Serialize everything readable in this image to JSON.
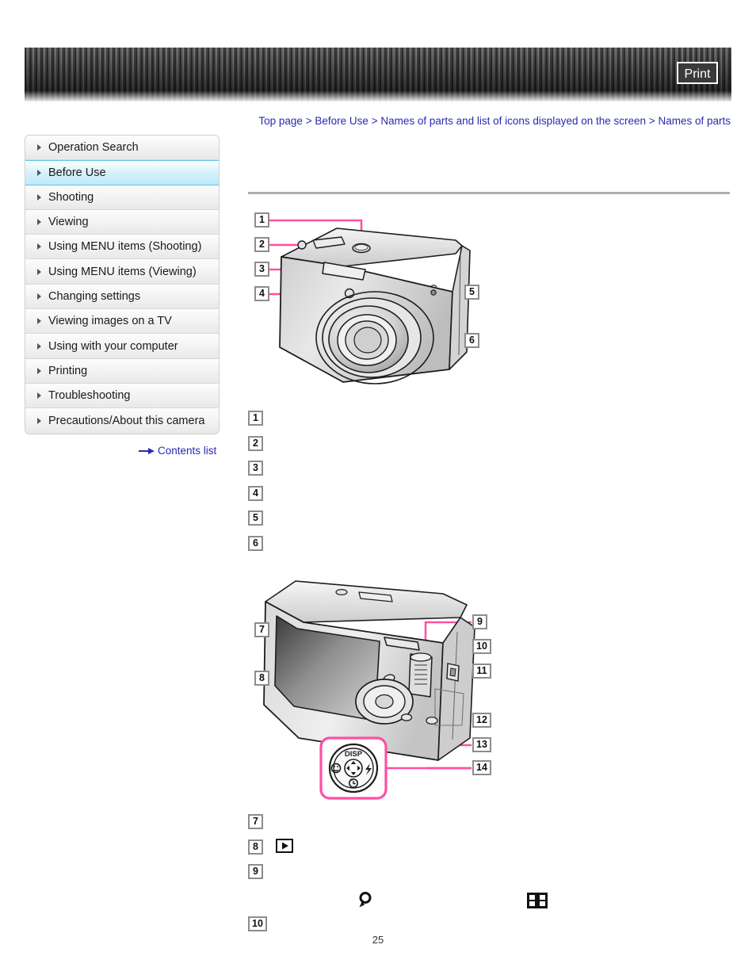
{
  "banner": {
    "print_label": "Print"
  },
  "breadcrumb": {
    "separator": ">",
    "items": [
      {
        "label": "Top page"
      },
      {
        "label": "Before Use"
      },
      {
        "label": "Names of parts and list of icons displayed on the screen"
      },
      {
        "label": "Names of parts"
      }
    ]
  },
  "sidebar": {
    "items": [
      {
        "label": "Operation Search",
        "active": false
      },
      {
        "label": "Before Use",
        "active": true
      },
      {
        "label": "Shooting",
        "active": false
      },
      {
        "label": "Viewing",
        "active": false
      },
      {
        "label": "Using MENU items (Shooting)",
        "active": false
      },
      {
        "label": "Using MENU items (Viewing)",
        "active": false
      },
      {
        "label": "Changing settings",
        "active": false
      },
      {
        "label": "Viewing images on a TV",
        "active": false
      },
      {
        "label": "Using with your computer",
        "active": false
      },
      {
        "label": "Printing",
        "active": false
      },
      {
        "label": "Troubleshooting",
        "active": false
      },
      {
        "label": "Precautions/About this camera",
        "active": false
      }
    ],
    "contents_list_label": "Contents list"
  },
  "figures": {
    "front": {
      "callouts": [
        "1",
        "2",
        "3",
        "4",
        "5",
        "6"
      ]
    },
    "rear": {
      "callouts": [
        "7",
        "8",
        "9",
        "10",
        "11",
        "12",
        "13",
        "14"
      ],
      "wheel_labels": {
        "top": "DISP",
        "right": "flash-icon",
        "bottom": "self-timer-icon",
        "left": "smile-shutter-icon"
      }
    }
  },
  "part_list_front": [
    {
      "num": "1",
      "text": ""
    },
    {
      "num": "2",
      "text": ""
    },
    {
      "num": "3",
      "text": ""
    },
    {
      "num": "4",
      "text": ""
    },
    {
      "num": "5",
      "text": ""
    },
    {
      "num": "6",
      "text": ""
    }
  ],
  "part_list_rear": [
    {
      "num": "7",
      "text": ""
    },
    {
      "num": "8",
      "text": "",
      "icon": "playback-icon"
    },
    {
      "num": "9",
      "text": "",
      "icon2": "zoom-magnifier-icon",
      "icon3": "index-grid-icon"
    },
    {
      "num": "10",
      "text": ""
    }
  ],
  "footer": {
    "page_number": "25"
  },
  "colors": {
    "link": "#2a2ab0",
    "callout_pink": "#ff4fa3",
    "sidebar_active": "#bfeaf8",
    "divider": "#aeaeae"
  }
}
